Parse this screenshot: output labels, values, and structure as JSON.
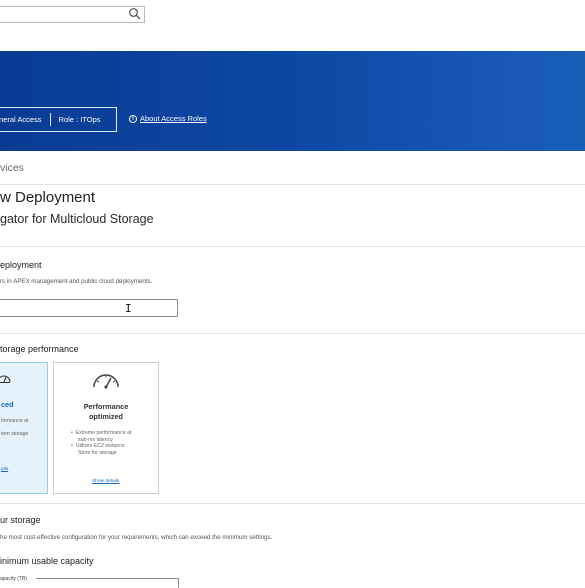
{
  "search": {
    "value": ""
  },
  "banner": {
    "general_access": "neral Access",
    "role": "Role : ITOps",
    "about_link": "About Access Roles",
    "info_glyph": "i"
  },
  "breadcrumb": "vices",
  "page": {
    "title": "w Deployment",
    "subtitle": "gator for Multicloud Storage"
  },
  "deployment": {
    "title": "eployment",
    "description": "rs in APEX management and public cloud deployments.",
    "cursor": "I"
  },
  "performance": {
    "title": "torage performance",
    "cards": [
      {
        "title": "ced",
        "bullets": [
          "formance at",
          "",
          "tem storage"
        ],
        "link": "ails",
        "selected": true
      },
      {
        "title_line1": "Performance",
        "title_line2": "optimized",
        "bullets": [
          "Extreme performance at",
          "sub-ms latency",
          "Utilizes EC2 instance",
          "Store for storage"
        ],
        "link": "Show details",
        "selected": false
      }
    ]
  },
  "storage": {
    "title": "ur storage",
    "description": "he most cost-effective configuration for your requirements, which can exceed the minimum settings."
  },
  "capacity": {
    "title": "inimum usable capacity",
    "field_label": "apacity (TB)"
  },
  "colors": {
    "banner": "#0d4aa6",
    "selected_card_bg": "#e6f2fb",
    "selected_card_border": "#9ccaf0",
    "link": "#1466c3"
  }
}
